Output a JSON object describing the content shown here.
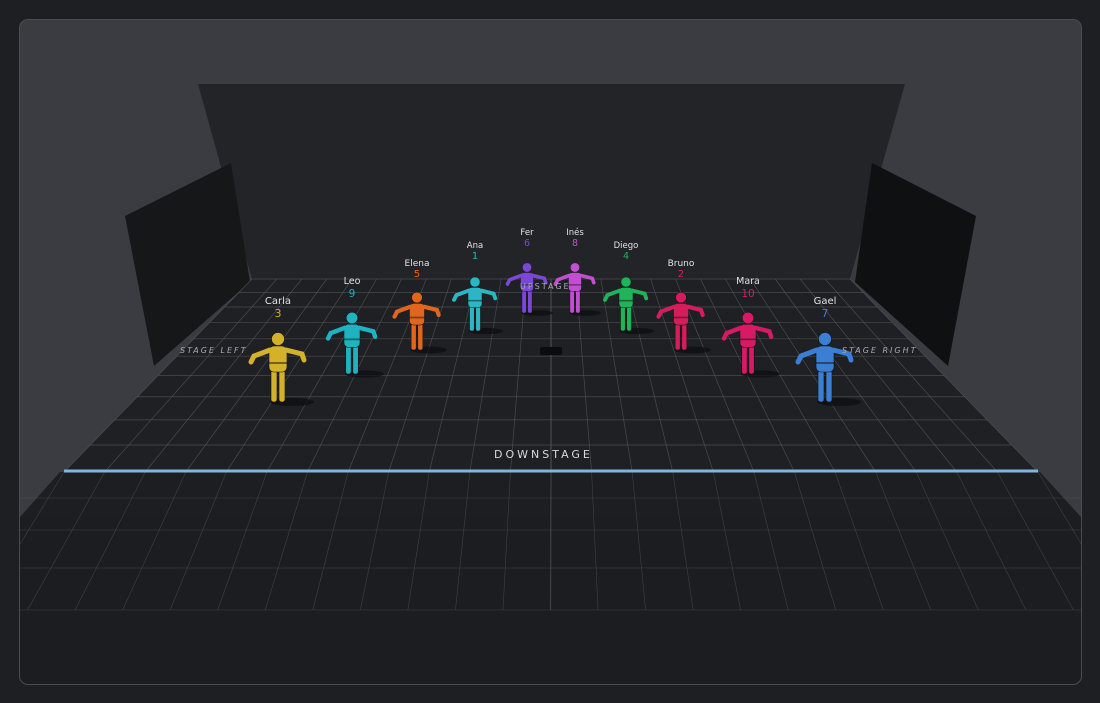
{
  "stage": {
    "labels": {
      "downstage": "DOWNSTAGE",
      "upstage": "UPSTAGE",
      "stage_left": "STAGE LEFT",
      "stage_right": "STAGE RIGHT"
    },
    "colors": {
      "background": "#1e1f22",
      "viewport": "#3a3c41",
      "floor": "#1c1d20",
      "grid": "#55585f",
      "front_edge": "#7fb5e0"
    }
  },
  "dancers": [
    {
      "name": "Carla",
      "number": "3",
      "color": "#d4b12a"
    },
    {
      "name": "Leo",
      "number": "9",
      "color": "#1fb3c2"
    },
    {
      "name": "Elena",
      "number": "5",
      "color": "#e0661e"
    },
    {
      "name": "Ana",
      "number": "1",
      "color": "#2bb6c4"
    },
    {
      "name": "Fer",
      "number": "6",
      "color": "#7b48d6"
    },
    {
      "name": "Inés",
      "number": "8",
      "color": "#c24fd1"
    },
    {
      "name": "Diego",
      "number": "4",
      "color": "#1fb35a"
    },
    {
      "name": "Bruno",
      "number": "2",
      "color": "#d41e5c"
    },
    {
      "name": "Mara",
      "number": "10",
      "color": "#d81a66"
    },
    {
      "name": "Gael",
      "number": "7",
      "color": "#3b7fd4"
    }
  ]
}
